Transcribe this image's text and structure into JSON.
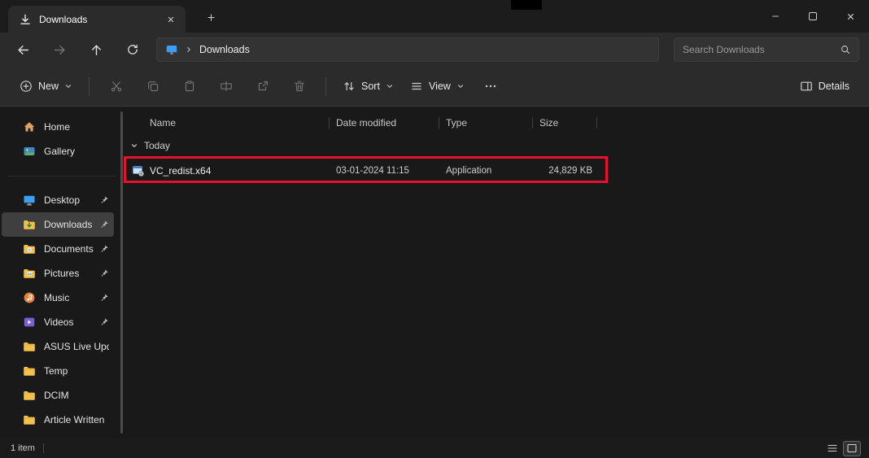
{
  "colors": {
    "highlight_red": "#e8112d",
    "selection_bg": "#3f3f3f",
    "folder_yellow": "#f2c14b",
    "band_bg": "#2b2b2b",
    "content_bg": "#191919"
  },
  "window": {
    "tab_title": "Downloads"
  },
  "navbar": {
    "breadcrumb_location": "Downloads",
    "search_placeholder": "Search Downloads"
  },
  "toolbar": {
    "new": "New",
    "sort": "Sort",
    "view": "View",
    "details": "Details"
  },
  "sidebar": {
    "items": [
      {
        "label": "Home",
        "icon": "home-icon",
        "pinned": false
      },
      {
        "label": "Gallery",
        "icon": "gallery-icon",
        "pinned": false
      },
      {
        "label": "Desktop",
        "icon": "desktop-icon",
        "pinned": true
      },
      {
        "label": "Downloads",
        "icon": "downloads-icon",
        "pinned": true,
        "selected": true
      },
      {
        "label": "Documents",
        "icon": "documents-icon",
        "pinned": true
      },
      {
        "label": "Pictures",
        "icon": "pictures-icon",
        "pinned": true
      },
      {
        "label": "Music",
        "icon": "music-icon",
        "pinned": true
      },
      {
        "label": "Videos",
        "icon": "videos-icon",
        "pinned": true
      },
      {
        "label": "ASUS Live Upda",
        "icon": "folder-icon",
        "pinned": false
      },
      {
        "label": "Temp",
        "icon": "folder-icon",
        "pinned": false
      },
      {
        "label": "DCIM",
        "icon": "folder-icon",
        "pinned": false
      },
      {
        "label": "Article Written",
        "icon": "folder-icon",
        "pinned": false
      }
    ]
  },
  "filelist": {
    "columns": [
      "Name",
      "Date modified",
      "Type",
      "Size"
    ],
    "group_label": "Today",
    "rows": [
      {
        "name": "VC_redist.x64",
        "date_modified": "03-01-2024 11:15",
        "type": "Application",
        "size": "24,829 KB",
        "icon": "installer-icon",
        "highlighted": true
      }
    ]
  },
  "statusbar": {
    "item_count": "1 item"
  },
  "icons": {
    "window": [
      "download-icon",
      "close-icon",
      "plus-icon",
      "minimize-icon",
      "maximize-icon"
    ],
    "navigation": [
      "back-icon",
      "forward-icon",
      "up-icon",
      "refresh-icon",
      "monitor-icon",
      "chevron-right-icon",
      "search-icon"
    ],
    "toolbar": [
      "plus-circle-icon",
      "chevron-down-icon",
      "cut-icon",
      "copy-icon",
      "paste-icon",
      "rename-icon",
      "share-icon",
      "delete-icon",
      "sort-icon",
      "view-icon",
      "more-icon",
      "details-pane-icon"
    ],
    "sidebar": [
      "home-icon",
      "gallery-icon",
      "desktop-icon",
      "downloads-icon",
      "documents-icon",
      "pictures-icon",
      "music-icon",
      "videos-icon",
      "folder-icon",
      "pin-icon"
    ],
    "statusbar": [
      "list-view-icon",
      "thumbnail-view-icon"
    ]
  }
}
